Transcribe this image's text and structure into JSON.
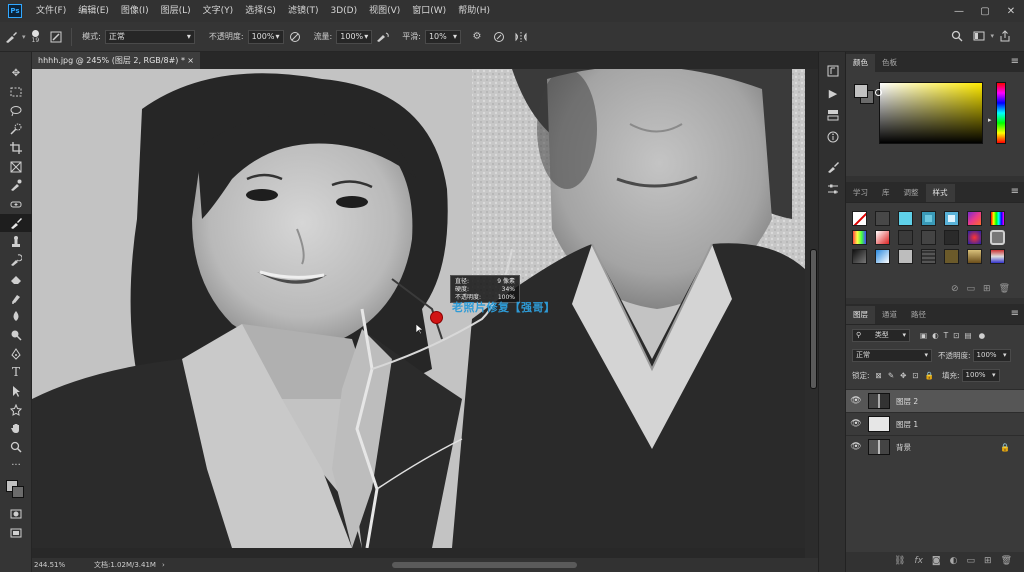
{
  "app": {
    "logo": "Ps"
  },
  "menu": [
    "文件(F)",
    "编辑(E)",
    "图像(I)",
    "图层(L)",
    "文字(Y)",
    "选择(S)",
    "滤镜(T)",
    "3D(D)",
    "视图(V)",
    "窗口(W)",
    "帮助(H)"
  ],
  "window_controls": [
    "—",
    "▢",
    "✕"
  ],
  "options": {
    "brush_size": "19",
    "mode_label": "模式:",
    "mode_value": "正常",
    "opacity_label": "不透明度:",
    "opacity_value": "100%",
    "flow_label": "流量:",
    "flow_value": "100%",
    "smoothing_label": "平滑:",
    "smoothing_value": "10%"
  },
  "document": {
    "tab_title": "hhhh.jpg @ 245% (图层 2, RGB/8#) *",
    "close": "×"
  },
  "canvas": {
    "tooltip": [
      {
        "label": "直径:",
        "value": "9 像素"
      },
      {
        "label": "硬度:",
        "value": "34%"
      },
      {
        "label": "不透明度:",
        "value": "100%"
      }
    ],
    "watermark": "老照片修复【强哥】"
  },
  "status": {
    "zoom": "244.51%",
    "doc_info": "文档:1.02M/3.41M"
  },
  "color_panel": {
    "tabs": [
      "颜色",
      "色板"
    ],
    "fg": "#c2c2c2",
    "bg": "#6b6b6b"
  },
  "styles_panel": {
    "tabs": [
      "学习",
      "库",
      "调整",
      "样式"
    ]
  },
  "layers_panel": {
    "tabs": [
      "图层",
      "通道",
      "路径"
    ],
    "filter_label": "类型",
    "blend_mode": "正常",
    "opacity_label": "不透明度:",
    "opacity_value": "100%",
    "lock_label": "锁定:",
    "fill_label": "填充:",
    "fill_value": "100%",
    "layers": [
      {
        "name": "图层 2",
        "selected": true,
        "locked": false
      },
      {
        "name": "图层 1",
        "selected": false,
        "locked": false
      },
      {
        "name": "背景",
        "selected": false,
        "locked": true
      }
    ]
  }
}
